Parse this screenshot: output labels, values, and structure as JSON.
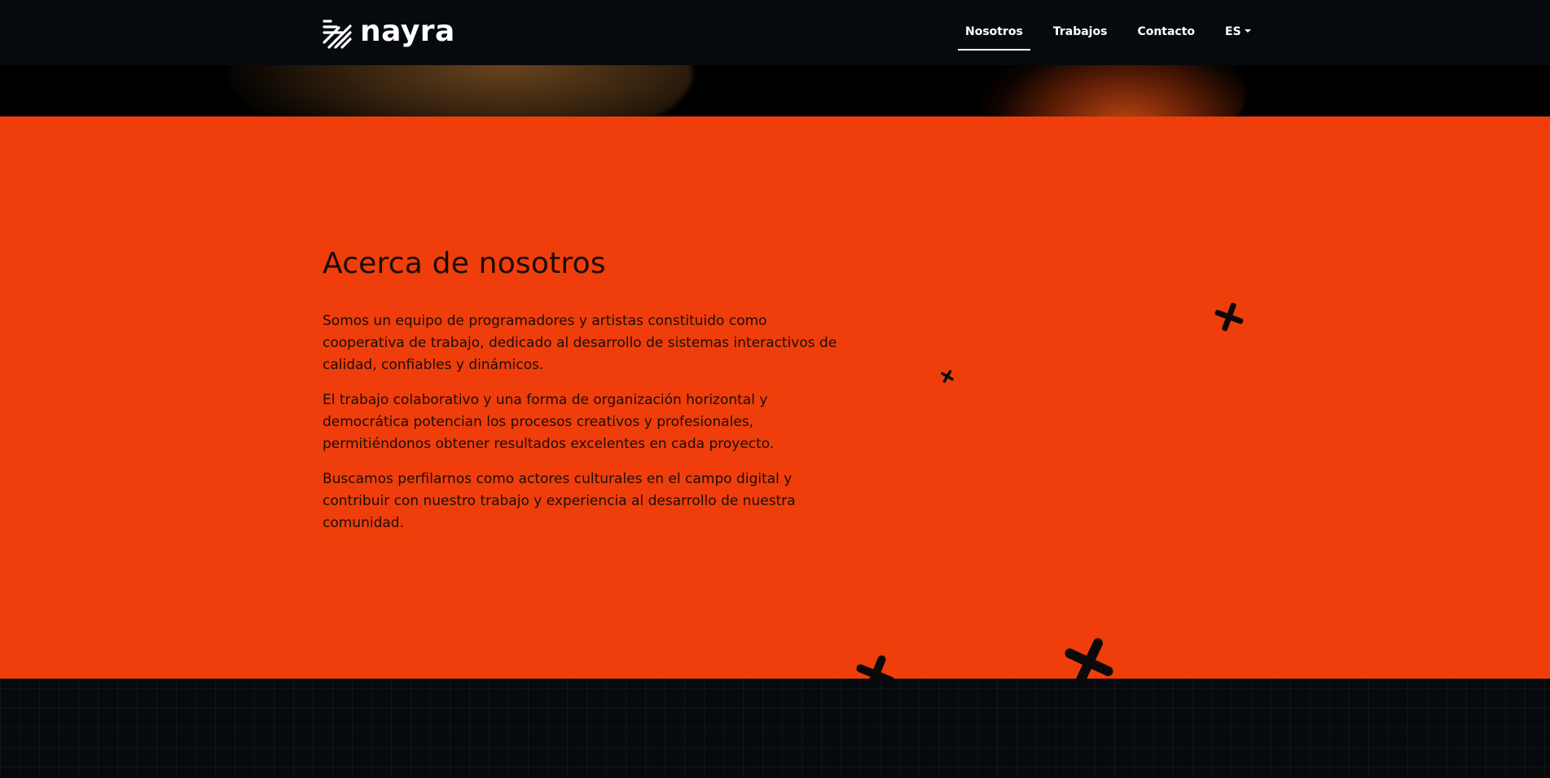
{
  "brand": {
    "name": "nayra",
    "icon": "nayra-logo-icon"
  },
  "nav": {
    "items": [
      {
        "label": "Nosotros",
        "active": true
      },
      {
        "label": "Trabajos",
        "active": false
      },
      {
        "label": "Contacto",
        "active": false
      }
    ],
    "language": "ES"
  },
  "about": {
    "title": "Acerca de nosotros",
    "paragraphs": [
      "Somos un equipo de programadores y artistas constituido como cooperativa de trabajo, dedicado al desarrollo de sistemas interactivos de calidad, confiables y dinámicos.",
      "El trabajo colaborativo y una forma de organización horizontal y democrática potencian los procesos creativos y profesionales, permitiéndonos obtener resultados excelentes en cada proyecto.",
      "Buscamos perfilarnos como actores culturales en el campo digital y contribuir con nuestro trabajo y experiencia al desarrollo de nuestra comunidad."
    ]
  },
  "colors": {
    "navbar_bg": "#060a0e",
    "accent_orange": "#ef3e0b",
    "text_dark": "#1c0d05",
    "text_light": "#ffffff"
  },
  "decorations": {
    "cross_icon": "cross-icon"
  }
}
